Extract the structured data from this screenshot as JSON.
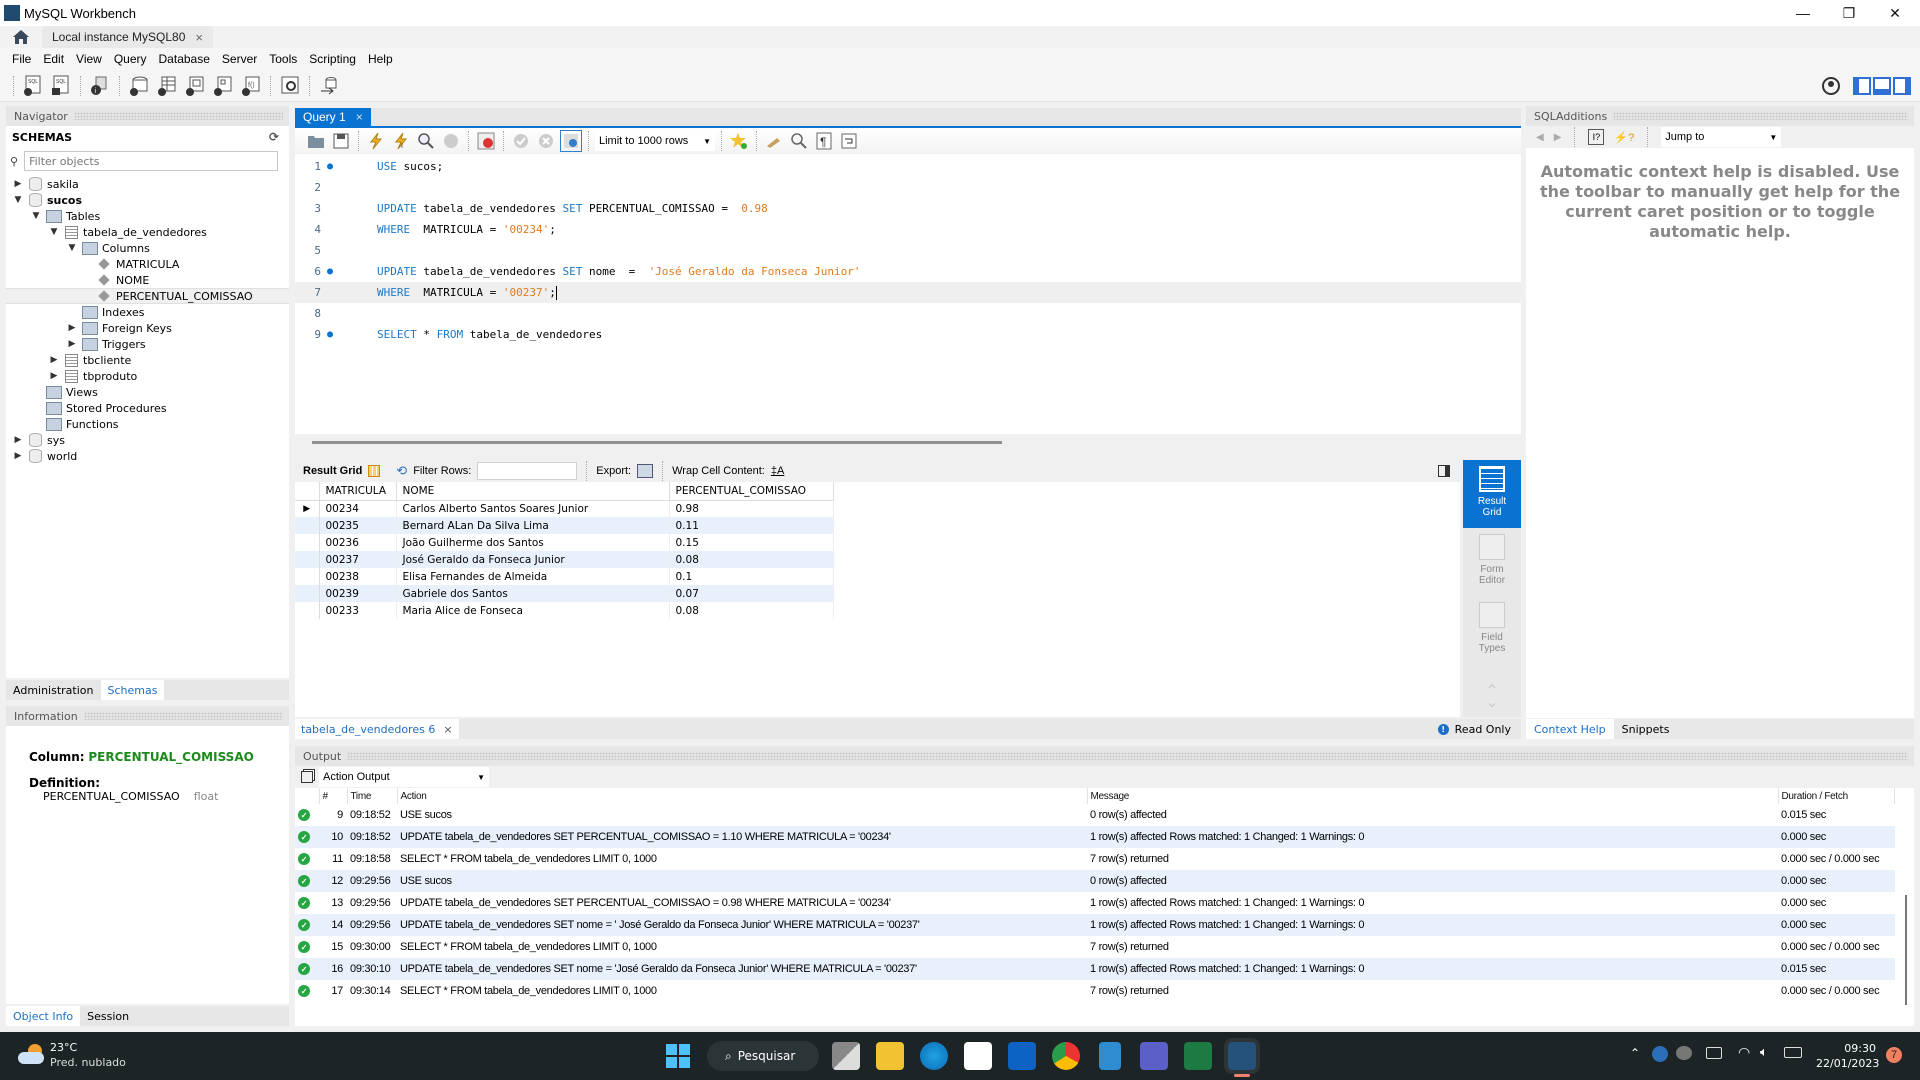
{
  "window": {
    "title": "MySQL Workbench",
    "minimize": "—",
    "restore": "❐",
    "close": "✕"
  },
  "tabs": {
    "home_icon": "home-icon",
    "instance_tab": "Local instance MySQL80",
    "close": "×"
  },
  "menu": [
    "File",
    "Edit",
    "View",
    "Query",
    "Database",
    "Server",
    "Tools",
    "Scripting",
    "Help"
  ],
  "navigator": {
    "header": "Navigator",
    "schemas_label": "SCHEMAS",
    "filter_placeholder": "Filter objects",
    "tree": [
      {
        "label": "sakila",
        "level": 0,
        "type": "db",
        "expanded": false
      },
      {
        "label": "sucos",
        "level": 0,
        "type": "db",
        "expanded": true,
        "bold": true
      },
      {
        "label": "Tables",
        "level": 1,
        "type": "group",
        "expanded": true
      },
      {
        "label": "tabela_de_vendedores",
        "level": 2,
        "type": "table",
        "expanded": true
      },
      {
        "label": "Columns",
        "level": 3,
        "type": "group",
        "expanded": true
      },
      {
        "label": "MATRICULA",
        "level": 4,
        "type": "column"
      },
      {
        "label": "NOME",
        "level": 4,
        "type": "column"
      },
      {
        "label": "PERCENTUAL_COMISSAO",
        "level": 4,
        "type": "column",
        "selected": true
      },
      {
        "label": "Indexes",
        "level": 3,
        "type": "group"
      },
      {
        "label": "Foreign Keys",
        "level": 3,
        "type": "group",
        "expanded": false
      },
      {
        "label": "Triggers",
        "level": 3,
        "type": "group",
        "expanded": false
      },
      {
        "label": "tbcliente",
        "level": 2,
        "type": "table",
        "expanded": false
      },
      {
        "label": "tbproduto",
        "level": 2,
        "type": "table",
        "expanded": false
      },
      {
        "label": "Views",
        "level": 1,
        "type": "group"
      },
      {
        "label": "Stored Procedures",
        "level": 1,
        "type": "group"
      },
      {
        "label": "Functions",
        "level": 1,
        "type": "group"
      },
      {
        "label": "sys",
        "level": 0,
        "type": "db",
        "expanded": false
      },
      {
        "label": "world",
        "level": 0,
        "type": "db",
        "expanded": false
      }
    ],
    "bottom_tabs": [
      "Administration",
      "Schemas"
    ],
    "active_bottom_tab": "Schemas"
  },
  "information": {
    "header": "Information",
    "column_label": "Column:",
    "column_value": "PERCENTUAL_COMISSAO",
    "definition_label": "Definition:",
    "definition_name": "PERCENTUAL_COMISSAO",
    "definition_type": "float",
    "tabs": [
      "Object Info",
      "Session"
    ],
    "active_tab": "Object Info"
  },
  "query_tab": {
    "label": "Query 1",
    "close": "×"
  },
  "query_toolbar": {
    "limit": "Limit to 1000 rows"
  },
  "editor": {
    "lines": [
      {
        "n": "1",
        "bp": true,
        "tokens": [
          [
            "kw",
            "USE"
          ],
          [
            "",
            "&nbsp;sucos;"
          ]
        ]
      },
      {
        "n": "2",
        "bp": false,
        "tokens": []
      },
      {
        "n": "3",
        "bp": false,
        "tokens": [
          [
            "kw",
            "UPDATE"
          ],
          [
            "",
            "&nbsp;tabela_de_vendedores&nbsp;"
          ],
          [
            "kw",
            "SET"
          ],
          [
            "",
            "&nbsp;PERCENTUAL_COMISSAO&nbsp;=&nbsp;&nbsp;"
          ],
          [
            "num",
            "0.98"
          ]
        ]
      },
      {
        "n": "4",
        "bp": false,
        "tokens": [
          [
            "kw",
            "WHERE"
          ],
          [
            "",
            "&nbsp;&nbsp;MATRICULA&nbsp;=&nbsp;"
          ],
          [
            "str",
            "'00234'"
          ],
          [
            "",
            ";"
          ]
        ]
      },
      {
        "n": "5",
        "bp": false,
        "tokens": []
      },
      {
        "n": "6",
        "bp": true,
        "tokens": [
          [
            "kw",
            "UPDATE"
          ],
          [
            "",
            "&nbsp;tabela_de_vendedores&nbsp;"
          ],
          [
            "kw",
            "SET"
          ],
          [
            "",
            "&nbsp;nome&nbsp;&nbsp;=&nbsp;&nbsp;"
          ],
          [
            "str",
            "'José Geraldo da Fonseca Junior'"
          ]
        ]
      },
      {
        "n": "7",
        "bp": false,
        "current": true,
        "tokens": [
          [
            "kw",
            "WHERE"
          ],
          [
            "",
            "&nbsp;&nbsp;MATRICULA&nbsp;=&nbsp;"
          ],
          [
            "str",
            "'00237'"
          ],
          [
            "",
            ";"
          ]
        ]
      },
      {
        "n": "8",
        "bp": false,
        "tokens": []
      },
      {
        "n": "9",
        "bp": true,
        "tokens": [
          [
            "kw",
            "SELECT"
          ],
          [
            "",
            "&nbsp;*&nbsp;"
          ],
          [
            "kw",
            "FROM"
          ],
          [
            "",
            "&nbsp;tabela_de_vendedores"
          ]
        ]
      }
    ]
  },
  "result_toolbar": {
    "result_grid": "Result Grid",
    "filter_rows": "Filter Rows:",
    "export": "Export:",
    "wrap": "Wrap Cell Content:"
  },
  "result_grid": {
    "columns": [
      "MATRICULA",
      "NOME",
      "PERCENTUAL_COMISSAO"
    ],
    "rows": [
      [
        "00234",
        "Carlos Alberto Santos Soares Junior",
        "0.98"
      ],
      [
        "00235",
        "Bernard ALan Da Silva Lima",
        "0.11"
      ],
      [
        "00236",
        "João Guilherme dos Santos",
        "0.15"
      ],
      [
        "00237",
        "José Geraldo da Fonseca Junior",
        "0.08"
      ],
      [
        "00238",
        "Elisa Fernandes de Almeida",
        "0.1"
      ],
      [
        "00239",
        "Gabriele dos Santos",
        "0.07"
      ],
      [
        "00233",
        "Maria Alice de Fonseca",
        "0.08"
      ]
    ]
  },
  "side_panel": {
    "result_grid": [
      "Result",
      "Grid"
    ],
    "form_editor": [
      "Form",
      "Editor"
    ],
    "field_types": [
      "Field",
      "Types"
    ]
  },
  "result_tabs": {
    "tab": "tabela_de_vendedores 6",
    "close": "×",
    "read_only": "Read Only"
  },
  "sql_additions": {
    "header": "SQLAdditions",
    "jump_to": "Jump to",
    "help_text": "Automatic context help is disabled. Use the toolbar to manually get help for the current caret position or to toggle automatic help.",
    "tabs": [
      "Context Help",
      "Snippets"
    ],
    "active_tab": "Context Help"
  },
  "output": {
    "header": "Output",
    "selector": "Action Output",
    "columns": [
      "",
      "#",
      "Time",
      "Action",
      "Message",
      "Duration / Fetch"
    ],
    "rows": [
      {
        "n": "9",
        "time": "09:18:52",
        "action": "USE sucos",
        "message": "0 row(s) affected",
        "duration": "0.015 sec"
      },
      {
        "n": "10",
        "time": "09:18:52",
        "action": "UPDATE tabela_de_vendedores SET PERCENTUAL_COMISSAO =  1.10 WHERE  MATRICULA = '00234'",
        "message": "1 row(s) affected Rows matched: 1  Changed: 1  Warnings: 0",
        "duration": "0.000 sec"
      },
      {
        "n": "11",
        "time": "09:18:58",
        "action": "SELECT * FROM tabela_de_vendedores LIMIT 0, 1000",
        "message": "7 row(s) returned",
        "duration": "0.000 sec / 0.000 sec"
      },
      {
        "n": "12",
        "time": "09:29:56",
        "action": "USE sucos",
        "message": "0 row(s) affected",
        "duration": "0.000 sec"
      },
      {
        "n": "13",
        "time": "09:29:56",
        "action": "UPDATE tabela_de_vendedores SET PERCENTUAL_COMISSAO =  0.98 WHERE  MATRICULA = '00234'",
        "message": "1 row(s) affected Rows matched: 1  Changed: 1  Warnings: 0",
        "duration": "0.000 sec"
      },
      {
        "n": "14",
        "time": "09:29:56",
        "action": "UPDATE tabela_de_vendedores SET nome  =  ' José Geraldo da Fonseca Junior' WHERE  MATRICULA = '00237'",
        "message": "1 row(s) affected Rows matched: 1  Changed: 1  Warnings: 0",
        "duration": "0.000 sec"
      },
      {
        "n": "15",
        "time": "09:30:00",
        "action": "SELECT * FROM tabela_de_vendedores LIMIT 0, 1000",
        "message": "7 row(s) returned",
        "duration": "0.000 sec / 0.000 sec"
      },
      {
        "n": "16",
        "time": "09:30:10",
        "action": "UPDATE tabela_de_vendedores SET nome  =  'José Geraldo da Fonseca Junior' WHERE  MATRICULA = '00237'",
        "message": "1 row(s) affected Rows matched: 1  Changed: 1  Warnings: 0",
        "duration": "0.015 sec"
      },
      {
        "n": "17",
        "time": "09:30:14",
        "action": "SELECT * FROM tabela_de_vendedores LIMIT 0, 1000",
        "message": "7 row(s) returned",
        "duration": "0.000 sec / 0.000 sec"
      }
    ]
  },
  "taskbar": {
    "weather_temp": "23°C",
    "weather_desc": "Pred. nublado",
    "search": "Pesquisar",
    "time": "09:30",
    "date": "22/01/2023",
    "notifications": "7",
    "apps": [
      "task-view",
      "file-explorer",
      "edge",
      "store",
      "outlook",
      "chrome",
      "notepad",
      "teams",
      "excel",
      "mysql-workbench"
    ]
  },
  "colors": {
    "accent": "#0a73d2",
    "keyword": "#1c79c8",
    "string": "#e07a1c",
    "ok": "#26a642",
    "column_name": "#1c8a1c"
  }
}
